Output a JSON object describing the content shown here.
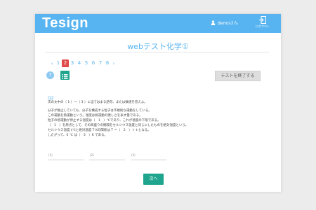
{
  "header": {
    "logo": "Tesign",
    "user": "demoさん",
    "logout_label": "ログアウト"
  },
  "page_title": "webテスト化学①",
  "pagination": {
    "prev": "‹",
    "next": "›",
    "pages": [
      "1",
      "2",
      "3",
      "4",
      "5",
      "6",
      "7",
      "8"
    ],
    "current": "2"
  },
  "toolbar": {
    "help": "?",
    "end_test": "テストを終了する"
  },
  "question": {
    "number": "Q2",
    "prompt": "次の文中の（ 1 ）～（ 3 ）に当てはまる語句、または数値を答えよ。",
    "lines": [
      "分子が静止していても、分子を構成する粒子は不規則な運動をしている。",
      "この運動を熱運動という。温度は熱運動の激しさを表す量である。",
      "粒子の熱運動が停止する温度は（　1　）℃であり、これが温度の下限である。",
      "（　1　）を原点として、その目盛りの間隔をセルシウス温度と同じにしたものを絶対温度という。",
      "セルシウス温度 t℃と絶対温度 T Kの関係は T ＝（　2　）＋ t となる。",
      "したがって、0 ℃ は（　3　）K である。"
    ],
    "answers": [
      "(1)",
      "(2)",
      "(3)"
    ]
  },
  "next_button": "次へ",
  "colors": {
    "header": "#58b4f0",
    "accent": "#1fa58e",
    "active_page": "#e04a4a"
  }
}
